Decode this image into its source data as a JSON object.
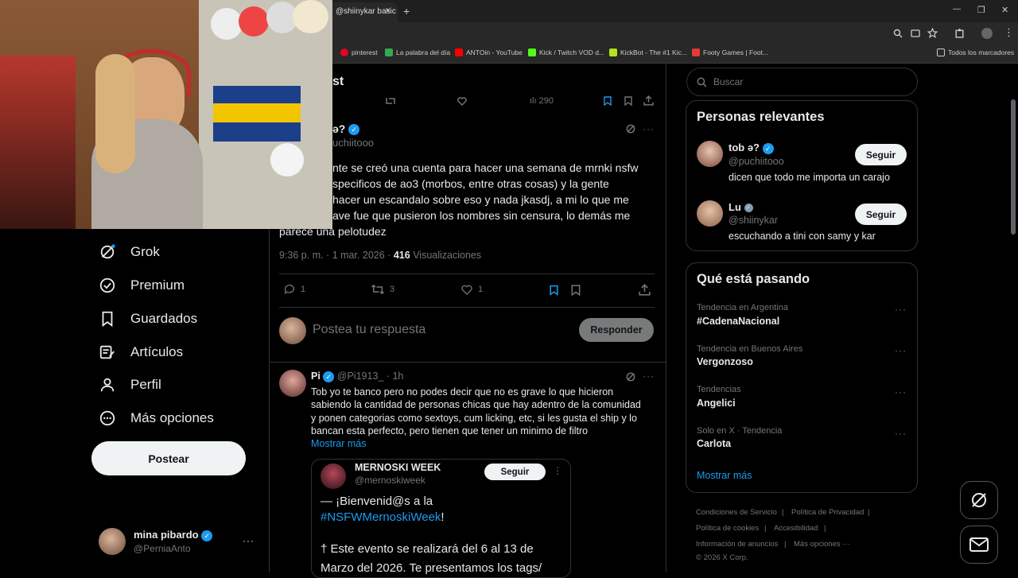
{
  "browser": {
    "tab_title": "@shiinykar basic",
    "tab_close": "✕",
    "new_tab": "+",
    "window_min": "—",
    "window_max": "❐",
    "window_close": "✕",
    "bookmarks": [
      {
        "label": "pinterest",
        "color": "#e60023"
      },
      {
        "label": "La palabra del día",
        "color": "#34a853"
      },
      {
        "label": "ANTOin - YouTube",
        "color": "#ff0000"
      },
      {
        "label": "Kick / Twitch VOD d...",
        "color": "#53fc18"
      },
      {
        "label": "KickBot - The #1 Kic...",
        "color": "#b6e21d"
      },
      {
        "label": "Footy Games | Foot...",
        "color": "#e53935"
      }
    ],
    "all_bookmarks": "Todos los marcadores"
  },
  "header": {
    "title_fragment": "st",
    "top_stats": {
      "views": "290"
    }
  },
  "nav": {
    "items": [
      {
        "label": "Grok",
        "icon": "grok-icon"
      },
      {
        "label": "Premium",
        "icon": "premium-icon"
      },
      {
        "label": "Guardados",
        "icon": "bookmark-icon"
      },
      {
        "label": "Artículos",
        "icon": "articles-icon"
      },
      {
        "label": "Perfil",
        "icon": "profile-icon"
      },
      {
        "label": "Más opciones",
        "icon": "more-options-icon"
      }
    ],
    "post_button": "Postear"
  },
  "account": {
    "name": "mina pibardo",
    "handle": "@PerniaAnto",
    "more": "···"
  },
  "tweet": {
    "author_fragment": "ə?",
    "handle_fragment": "uchiitooo",
    "text_lines": [
      "nte se creó una cuenta para hacer una semana de mrnki nsfw",
      "specificos de ao3 (morbos, entre otras cosas) y la gente",
      "hacer un escandalo sobre eso y nada jkasdj, a mi lo que me",
      "ave fue que pusieron los nombres sin censura, lo demás me",
      "parece una pelotudez"
    ],
    "time": "9:36 p. m. · 1 mar. 2026 ·",
    "views": "416",
    "views_label": "Visualizaciones",
    "replies": "1",
    "retweets": "3",
    "likes": "1",
    "more": "···"
  },
  "reply_box": {
    "placeholder": "Postea tu respuesta",
    "button": "Responder"
  },
  "reply": {
    "name": "Pi",
    "handle": "@Pi1913_",
    "time": "· 1h",
    "text_lines": [
      "Tob yo te banco pero no podes decir que no es grave lo que hicieron",
      "sabiendo la cantidad de personas chicas que hay adentro de la comunidad",
      "y ponen categorias como sextoys, cum licking, etc, si les gusta el ship y lo",
      "bancan esta perfecto, pero tienen que tener un minimo de filtro"
    ],
    "show_more": "Mostrar más",
    "more": "···"
  },
  "quoted": {
    "name": "MERNOSKI WEEK",
    "handle": "@mernoskiweek",
    "follow": "Seguir",
    "line1": "— ¡Bienvenid@s a la",
    "hashtag": "#NSFWMernoskiWeek",
    "line2_end": "!",
    "line3": "† Este evento se realizará del 6 al 13 de",
    "line4": "Marzo del 2026. Te presentamos los tags/"
  },
  "search": {
    "placeholder": "Buscar"
  },
  "relevant": {
    "title": "Personas relevantes",
    "people": [
      {
        "name": "tob ə?",
        "handle": "@puchiitooo",
        "bio": "dicen que todo me importa un carajo",
        "button": "Seguir"
      },
      {
        "name": "Lu",
        "handle": "@shiinykar",
        "bio": "escuchando a tini con samy y kar",
        "button": "Seguir"
      }
    ]
  },
  "trends": {
    "title": "Qué está pasando",
    "items": [
      {
        "context": "Tendencia en Argentina",
        "name": "#CadenaNacional"
      },
      {
        "context": "Tendencia en Buenos Aires",
        "name": "Vergonzoso"
      },
      {
        "context": "Tendencias",
        "name": "Angelici"
      },
      {
        "context": "Solo en X · Tendencia",
        "name": "Carlota"
      }
    ],
    "show_more": "Mostrar más",
    "more": "···"
  },
  "footer": {
    "links": [
      "Condiciones de Servicio",
      "Política de Privacidad",
      "Política de cookies",
      "Accesibilidad",
      "Información de anuncios",
      "Más opciones ···"
    ],
    "separator": "|",
    "copyright": "© 2026 X Corp."
  },
  "colors": {
    "accent": "#1d9bf0",
    "background": "#000000",
    "text": "#e7e9ea",
    "muted": "#71767b"
  }
}
